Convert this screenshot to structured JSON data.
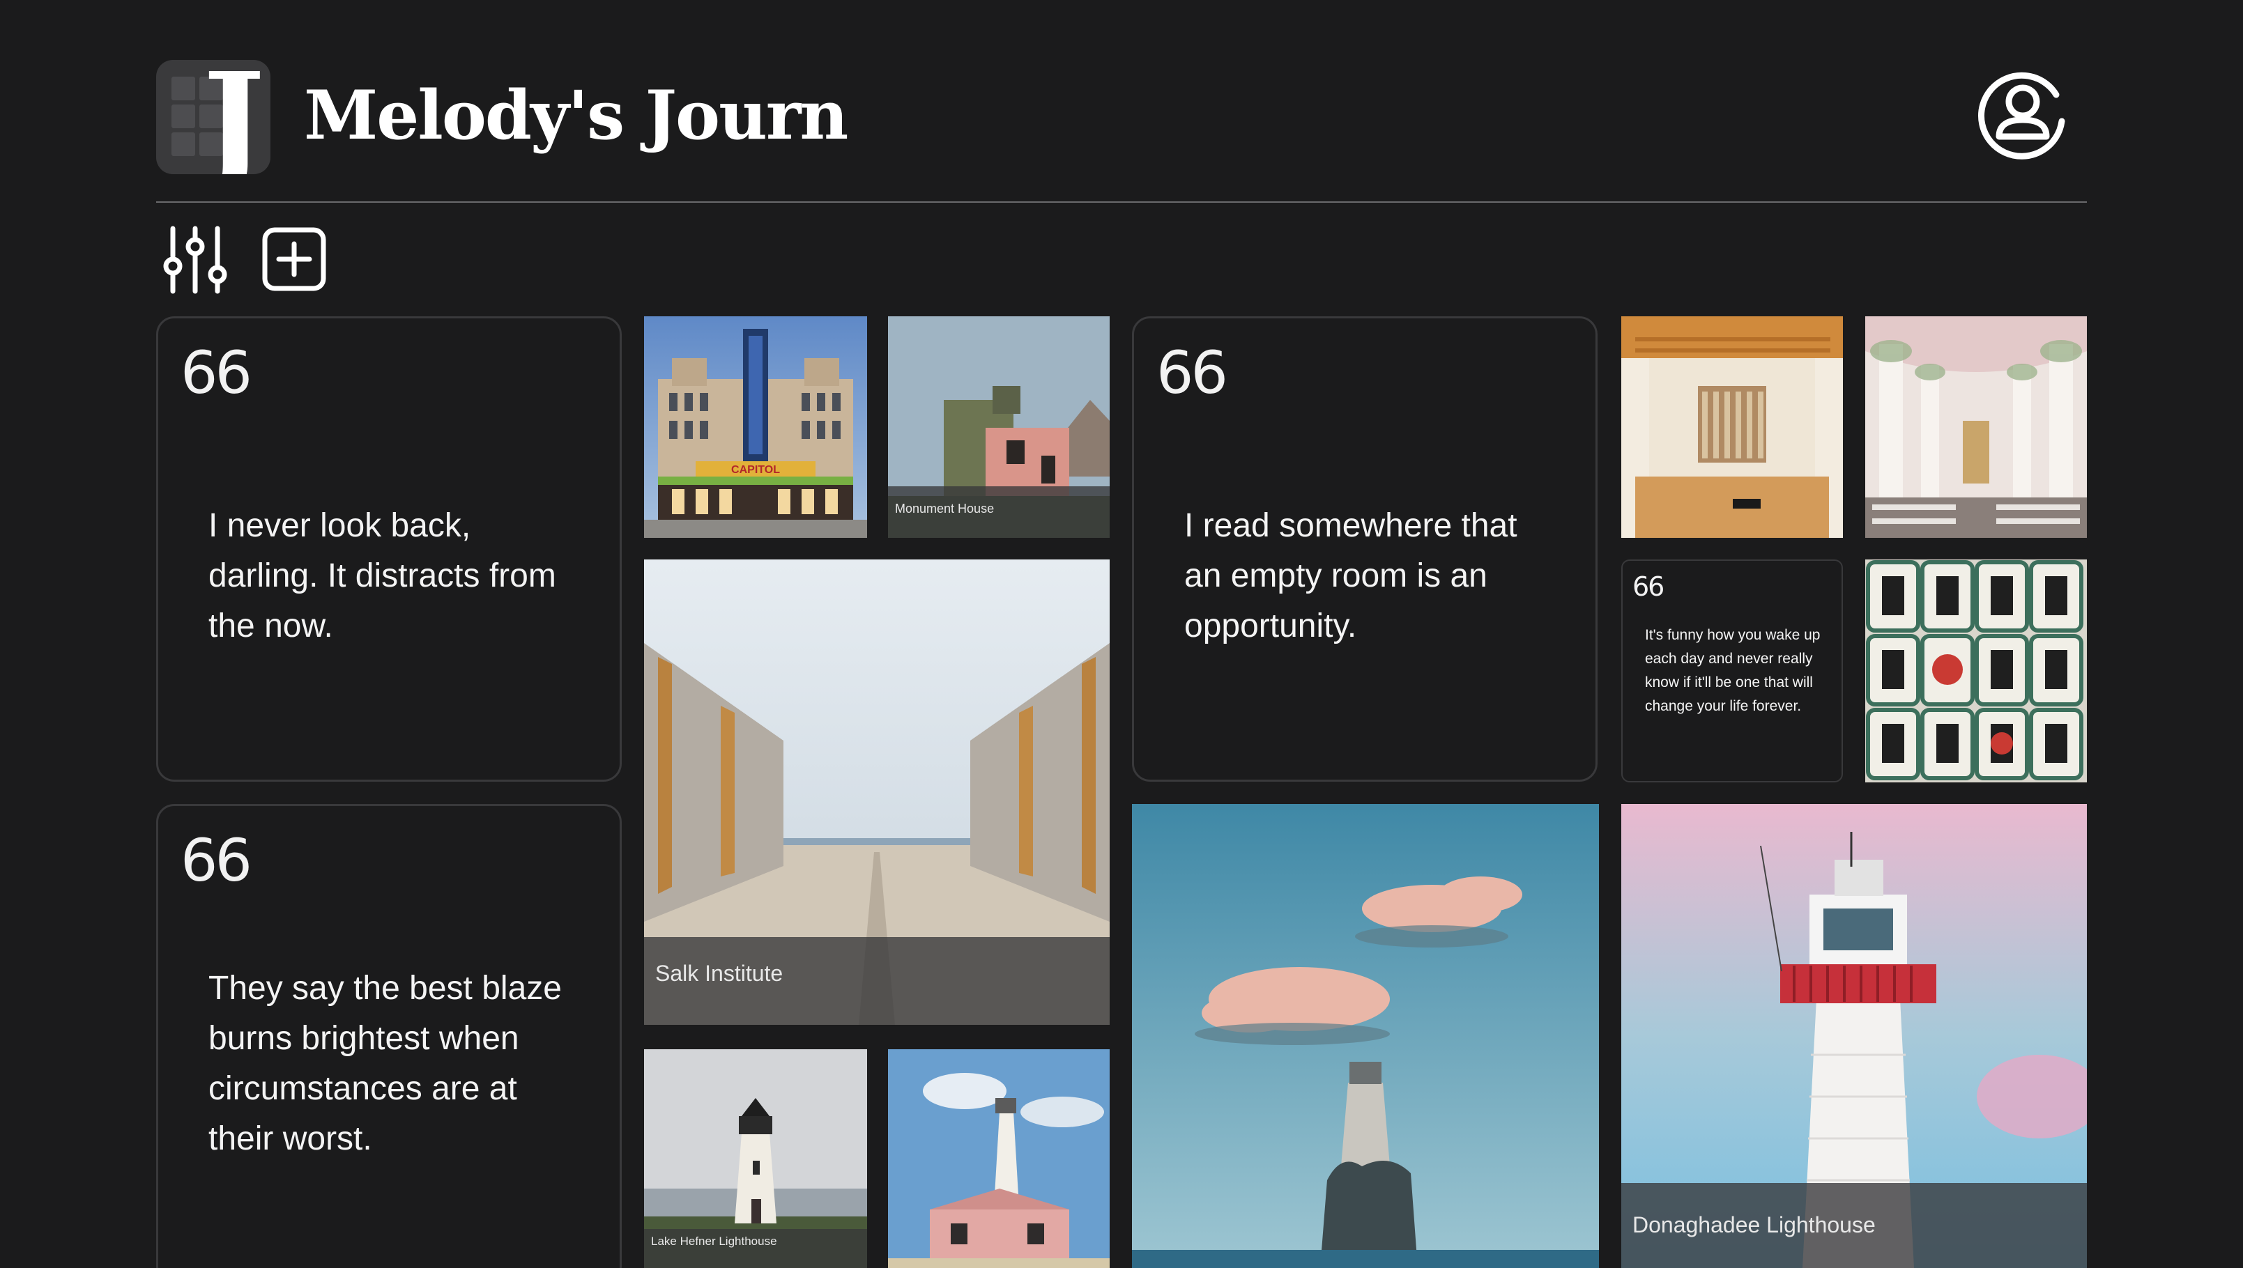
{
  "app": {
    "title": "Melody's Journ",
    "logo_letter": "J"
  },
  "header": {
    "profile_icon": "user-circle-icon"
  },
  "toolbar": {
    "filter_icon": "sliders-icon",
    "add_icon": "plus-square-icon"
  },
  "quotes": [
    {
      "mark": "66",
      "text": "I never look back, darling. It distracts from the now."
    },
    {
      "mark": "66",
      "text": "They say the best blaze burns brightest when circumstances are at their worst."
    },
    {
      "mark": "66",
      "text": "I read somewhere that an empty room is an opportunity."
    },
    {
      "mark": "66",
      "text": "It's funny how you wake up each day and never really know if it'll be one that will change your life forever."
    }
  ],
  "photos": {
    "capitol_theatre": {
      "sign": "CAPITOL"
    },
    "monument_house": {
      "caption": "Monument House"
    },
    "salk_institute": {
      "caption": "Salk Institute"
    },
    "lake_hefner": {
      "caption": "Lake Hefner Lighthouse"
    },
    "donaghadee": {
      "caption": "Donaghadee Lighthouse"
    }
  },
  "colors": {
    "background": "#1b1b1c",
    "card_border": "#39393b",
    "caption_bar": "#37373a",
    "text": "#ffffff"
  }
}
